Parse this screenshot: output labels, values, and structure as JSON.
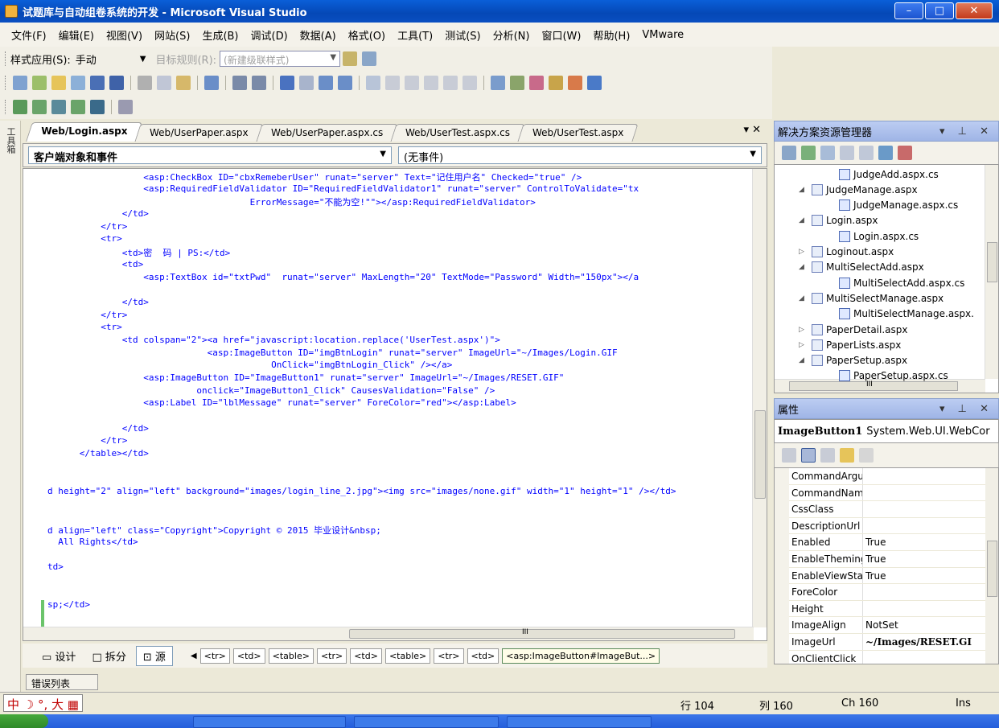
{
  "window": {
    "title": "试题库与自动组卷系统的开发 - Microsoft Visual Studio",
    "buttons": {
      "minimize": "–",
      "maximize": "□",
      "close": "✕"
    }
  },
  "menu": [
    "文件(F)",
    "编辑(E)",
    "视图(V)",
    "网站(S)",
    "生成(B)",
    "调试(D)",
    "数据(A)",
    "格式(O)",
    "工具(T)",
    "测试(S)",
    "分析(N)",
    "窗口(W)",
    "帮助(H)",
    "VMware"
  ],
  "style_toolbar": {
    "style_label": "样式应用(S):",
    "style_value": "手动",
    "target_label": "目标规则(R):",
    "target_value": "(新建级联样式)"
  },
  "editor": {
    "tabs": [
      "Web/Login.aspx",
      "Web/UserPaper.aspx",
      "Web/UserPaper.aspx.cs",
      "Web/UserTest.aspx.cs",
      "Web/UserTest.aspx"
    ],
    "tab_controls": "▾ ✕",
    "object_combo": "客户端对象和事件",
    "event_combo": "(无事件)",
    "lines": [
      "                  <asp:CheckBox ID=\"cbxRemeberUser\" runat=\"server\" Text=\"记住用户名\" Checked=\"true\" />",
      "                  <asp:RequiredFieldValidator ID=\"RequiredFieldValidator1\" runat=\"server\" ControlToValidate=\"tx",
      "                                      ErrorMessage=\"不能为空!\"\"></asp:RequiredFieldValidator>",
      "              </td>",
      "          </tr>",
      "          <tr>",
      "              <td>密  码 | PS:</td>",
      "              <td>",
      "                  <asp:TextBox id=\"txtPwd\"  runat=\"server\" MaxLength=\"20\" TextMode=\"Password\" Width=\"150px\"></a",
      "",
      "              </td>",
      "          </tr>",
      "          <tr>",
      "              <td colspan=\"2\"><a href=\"javascript:location.replace('UserTest.aspx')\">",
      "                              <asp:ImageButton ID=\"imgBtnLogin\" runat=\"server\" ImageUrl=\"~/Images/Login.GIF",
      "                                          OnClick=\"imgBtnLogin_Click\" /></a>",
      "                  <asp:ImageButton ID=\"ImageButton1\" runat=\"server\" ImageUrl=\"~/Images/RESET.GIF\"",
      "                            onclick=\"ImageButton1_Click\" CausesValidation=\"False\" />",
      "                  <asp:Label ID=\"lblMessage\" runat=\"server\" ForeColor=\"red\"></asp:Label>",
      "",
      "              </td>",
      "          </tr>",
      "      </table></td>",
      "",
      "",
      "d height=\"2\" align=\"left\" background=\"images/login_line_2.jpg\"><img src=\"images/none.gif\" width=\"1\" height=\"1\" /></td>",
      "",
      "",
      "d align=\"left\" class=\"Copyright\">Copyright © 2015 毕业设计&nbsp;",
      "  All Rights</td>",
      "",
      "td>",
      "",
      "",
      "sp;</td>"
    ],
    "h_scroll_label": "III",
    "view_buttons": [
      "设计",
      "拆分",
      "源"
    ],
    "breadcrumbs": [
      "<tr>",
      "<td>",
      "<table>",
      "<tr>",
      "<td>",
      "<table>",
      "<tr>",
      "<td>",
      "<asp:ImageButton#ImageBut...>"
    ],
    "error_list_tab": "错误列表"
  },
  "solution_explorer": {
    "title": "解决方案资源管理器",
    "controls": "▾ ⊥ ✕",
    "items": [
      {
        "label": "JudgeAdd.aspx.cs",
        "type": "cs",
        "indent": 2
      },
      {
        "label": "JudgeManage.aspx",
        "type": "aspx",
        "indent": 1,
        "expanded": true
      },
      {
        "label": "JudgeManage.aspx.cs",
        "type": "cs",
        "indent": 2
      },
      {
        "label": "Login.aspx",
        "type": "aspx",
        "indent": 1,
        "expanded": true
      },
      {
        "label": "Login.aspx.cs",
        "type": "cs",
        "indent": 2
      },
      {
        "label": "Loginout.aspx",
        "type": "aspx",
        "indent": 1,
        "expanded": false
      },
      {
        "label": "MultiSelectAdd.aspx",
        "type": "aspx",
        "indent": 1,
        "expanded": true
      },
      {
        "label": "MultiSelectAdd.aspx.cs",
        "type": "cs",
        "indent": 2
      },
      {
        "label": "MultiSelectManage.aspx",
        "type": "aspx",
        "indent": 1,
        "expanded": true
      },
      {
        "label": "MultiSelectManage.aspx.",
        "type": "cs",
        "indent": 2
      },
      {
        "label": "PaperDetail.aspx",
        "type": "aspx",
        "indent": 1,
        "expanded": false
      },
      {
        "label": "PaperLists.aspx",
        "type": "aspx",
        "indent": 1,
        "expanded": false
      },
      {
        "label": "PaperSetup.aspx",
        "type": "aspx",
        "indent": 1,
        "expanded": true
      },
      {
        "label": "PaperSetup.aspx.cs",
        "type": "cs",
        "indent": 2
      }
    ],
    "h_scroll_label": "III"
  },
  "properties": {
    "title": "属性",
    "controls": "▾ ⊥ ✕",
    "object_name": "ImageButton1",
    "object_type": "System.Web.UI.WebCor",
    "rows": [
      {
        "name": "CommandArgur",
        "value": ""
      },
      {
        "name": "CommandName",
        "value": ""
      },
      {
        "name": "CssClass",
        "value": ""
      },
      {
        "name": "DescriptionUrl",
        "value": ""
      },
      {
        "name": "Enabled",
        "value": "True"
      },
      {
        "name": "EnableTheming",
        "value": "True"
      },
      {
        "name": "EnableViewStat",
        "value": "True"
      },
      {
        "name": "ForeColor",
        "value": ""
      },
      {
        "name": "Height",
        "value": ""
      },
      {
        "name": "ImageAlign",
        "value": "NotSet"
      },
      {
        "name": "ImageUrl",
        "value": "~/Images/RESET.GI",
        "bold": true
      },
      {
        "name": "OnClientClick",
        "value": ""
      }
    ]
  },
  "statusbar": {
    "ime": "中 ☽ °, 大 ▦",
    "line": "行 104",
    "col": "列 160",
    "ch": "Ch 160",
    "mode": "Ins"
  },
  "colors": {
    "titlebar": "#0a5fd8",
    "code_tag": "#0000ff",
    "code_attr": "#ff0000",
    "code_element": "#a31515"
  }
}
